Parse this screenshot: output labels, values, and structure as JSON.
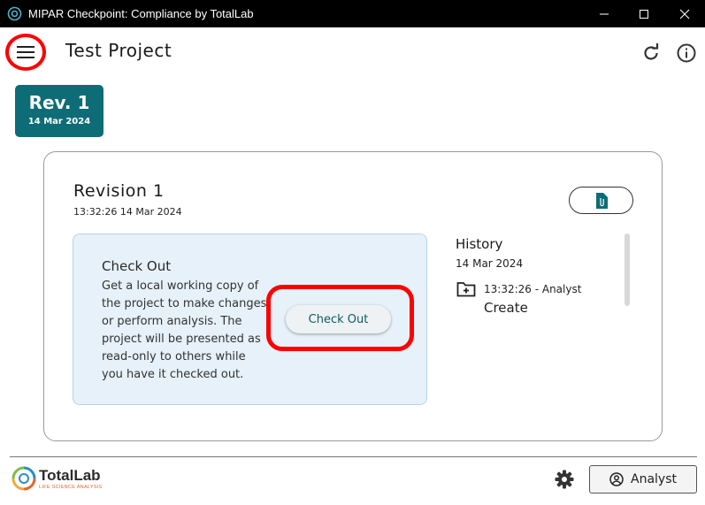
{
  "window": {
    "title": "MIPAR Checkpoint: Compliance by TotalLab",
    "minimize_icon": "minimize-icon",
    "maximize_icon": "maximize-icon",
    "close_icon": "close-icon"
  },
  "header": {
    "project_title": "Test Project",
    "menu_icon": "hamburger-menu-icon",
    "refresh_icon": "refresh-icon",
    "info_icon": "info-icon"
  },
  "revision_tab": {
    "label": "Rev. 1",
    "date": "14 Mar 2024",
    "color": "#0e6c76"
  },
  "revision": {
    "heading": "Revision 1",
    "timestamp": "13:32:26 14 Mar 2024",
    "attachment_icon": "document-attachment-icon"
  },
  "checkout": {
    "title": "Check Out",
    "description": "Get a local working copy of\nthe project to make changes\nor perform analysis. The\nproject will be presented as\nread-only to others while\nyou have it checked out.",
    "button_label": "Check Out"
  },
  "history": {
    "title": "History",
    "date": "14 Mar 2024",
    "entries": [
      {
        "time": "13:32:26 - Analyst",
        "action": "Create",
        "icon": "folder-add-icon"
      }
    ]
  },
  "footer": {
    "logo_text": "TotalLab",
    "logo_sub": "LIFE SCIENCE ANALYSIS",
    "settings_icon": "gear-icon",
    "user_label": "Analyst",
    "user_icon": "account-circle-icon"
  },
  "annotations": {
    "highlight_color": "#ff0000"
  }
}
